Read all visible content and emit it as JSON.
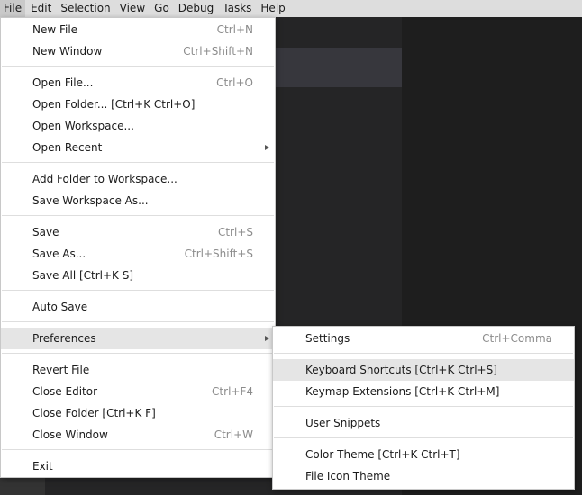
{
  "menubar": {
    "items": [
      "File",
      "Edit",
      "Selection",
      "View",
      "Go",
      "Debug",
      "Tasks",
      "Help"
    ]
  },
  "file_menu": {
    "new_file": {
      "label": "New File",
      "shortcut": "Ctrl+N"
    },
    "new_window": {
      "label": "New Window",
      "shortcut": "Ctrl+Shift+N"
    },
    "open_file": {
      "label": "Open File...",
      "shortcut": "Ctrl+O"
    },
    "open_folder": {
      "label": "Open Folder... [Ctrl+K Ctrl+O]"
    },
    "open_workspace": {
      "label": "Open Workspace..."
    },
    "open_recent": {
      "label": "Open Recent"
    },
    "add_folder": {
      "label": "Add Folder to Workspace..."
    },
    "save_workspace_as": {
      "label": "Save Workspace As..."
    },
    "save": {
      "label": "Save",
      "shortcut": "Ctrl+S"
    },
    "save_as": {
      "label": "Save As...",
      "shortcut": "Ctrl+Shift+S"
    },
    "save_all": {
      "label": "Save All [Ctrl+K S]"
    },
    "auto_save": {
      "label": "Auto Save"
    },
    "preferences": {
      "label": "Preferences"
    },
    "revert_file": {
      "label": "Revert File"
    },
    "close_editor": {
      "label": "Close Editor",
      "shortcut": "Ctrl+F4"
    },
    "close_folder": {
      "label": "Close Folder [Ctrl+K F]"
    },
    "close_window": {
      "label": "Close Window",
      "shortcut": "Ctrl+W"
    },
    "exit": {
      "label": "Exit"
    }
  },
  "preferences_menu": {
    "settings": {
      "label": "Settings",
      "shortcut": "Ctrl+Comma"
    },
    "keyboard_shortcuts": {
      "label": "Keyboard Shortcuts [Ctrl+K Ctrl+S]"
    },
    "keymap_extensions": {
      "label": "Keymap Extensions [Ctrl+K Ctrl+M]"
    },
    "user_snippets": {
      "label": "User Snippets"
    },
    "color_theme": {
      "label": "Color Theme [Ctrl+K Ctrl+T]"
    },
    "file_icon_theme": {
      "label": "File Icon Theme"
    }
  }
}
